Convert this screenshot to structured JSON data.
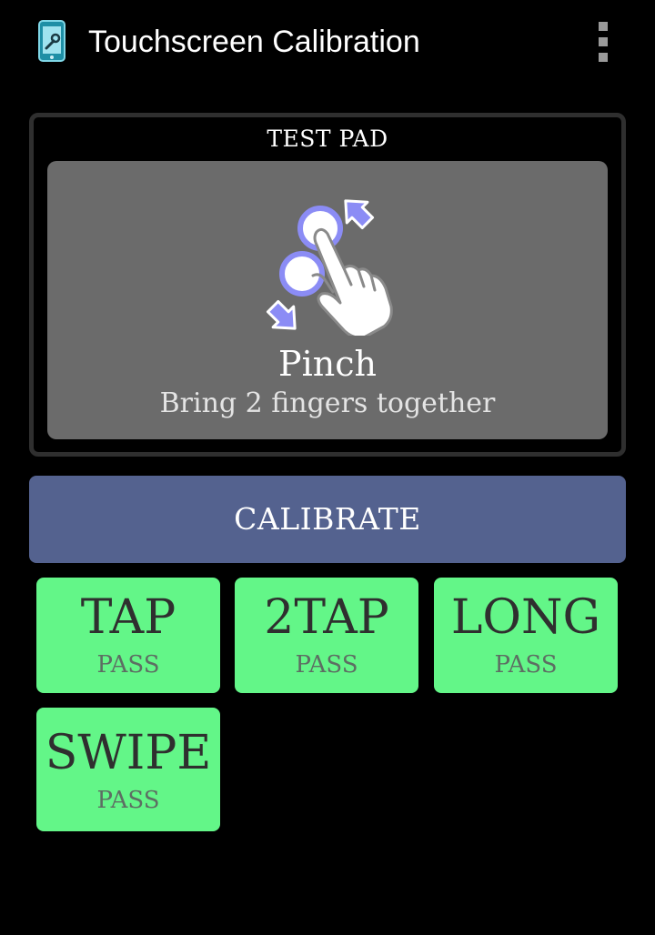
{
  "action_bar": {
    "title": "Touchscreen Calibration",
    "app_icon": "phone-wrench-icon",
    "overflow_icon": "overflow-menu-icon"
  },
  "test_pad": {
    "title": "TEST PAD",
    "gesture_icon": "pinch-gesture-icon",
    "gesture_name": "Pinch",
    "gesture_hint": "Bring 2 fingers together"
  },
  "calibrate_button": {
    "label": "CALIBRATE"
  },
  "results": [
    {
      "label": "TAP",
      "status": "PASS"
    },
    {
      "label": "2TAP",
      "status": "PASS"
    },
    {
      "label": "LONG",
      "status": "PASS"
    },
    {
      "label": "SWIPE",
      "status": "PASS"
    }
  ],
  "colors": {
    "background": "#000000",
    "pad_area": "#6b6b6b",
    "calibrate_button": "#54628f",
    "pass_tile": "#63f688",
    "gesture_accent": "#7b7bf0"
  }
}
